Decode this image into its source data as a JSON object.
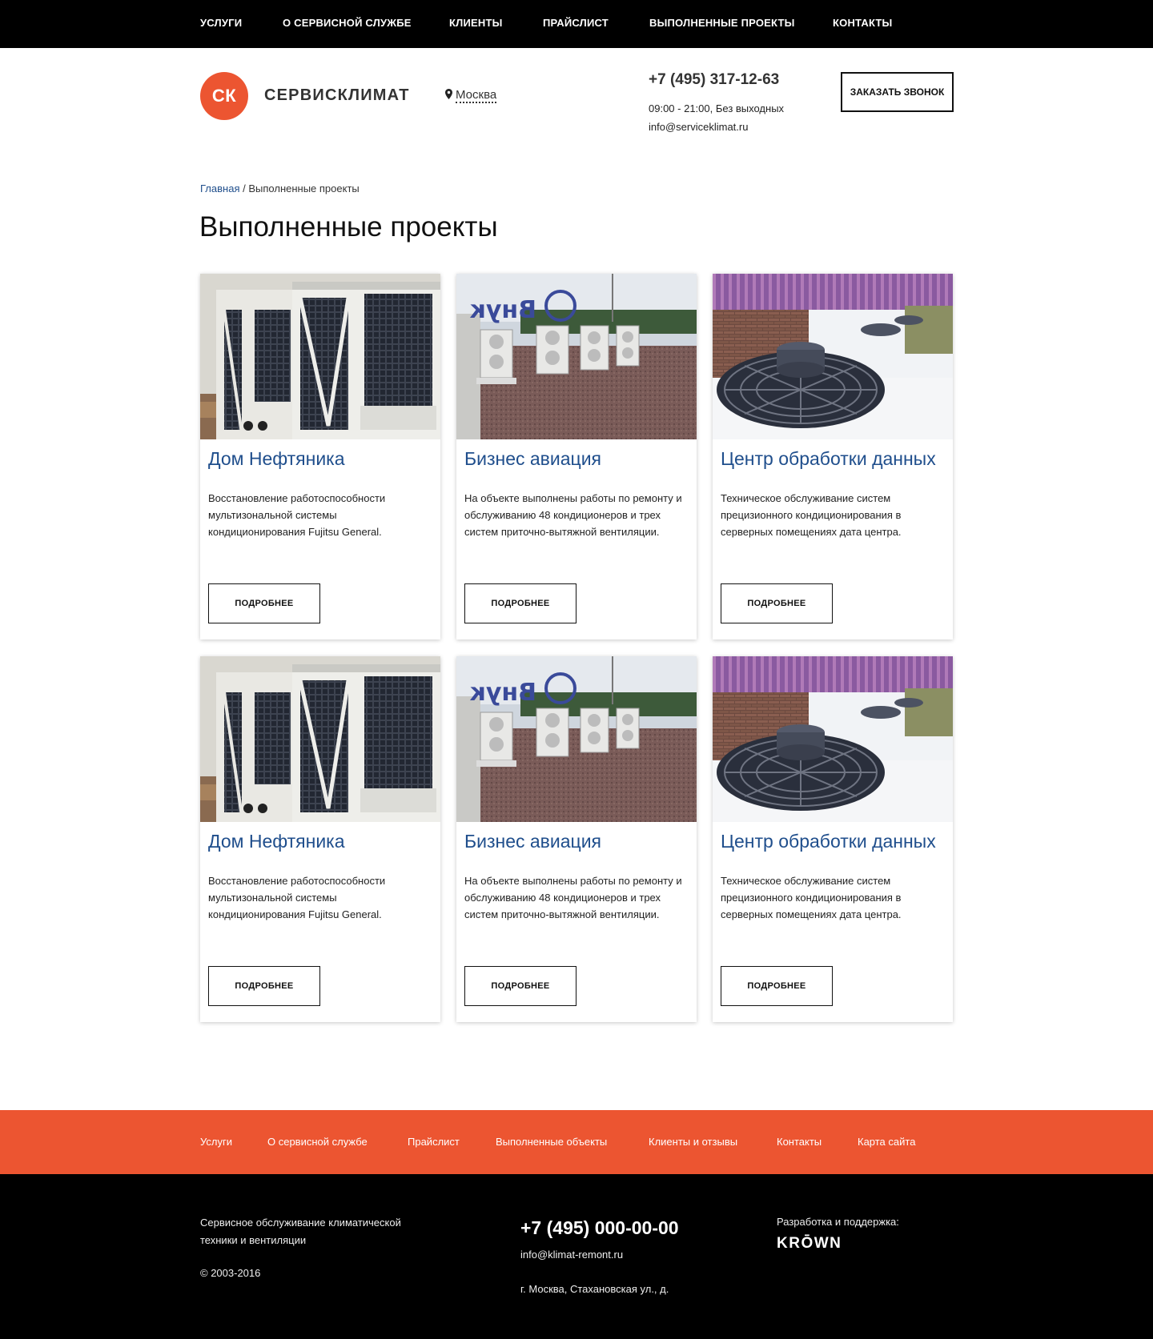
{
  "topnav": {
    "items": [
      {
        "label": "УСЛУГИ"
      },
      {
        "label": "О СЕРВИСНОЙ СЛУЖБЕ"
      },
      {
        "label": "КЛИЕНТЫ"
      },
      {
        "label": "ПРАЙСЛИСТ"
      },
      {
        "label": "ВЫПОЛНЕННЫЕ ПРОЕКТЫ"
      },
      {
        "label": "КОНТАКТЫ"
      }
    ]
  },
  "header": {
    "logo_mark": "СК",
    "logo_text": "СЕРВИСКЛИМАТ",
    "city_icon": "map-pin-icon",
    "city": "Москва",
    "phone": "+7 (495) 317-12-63",
    "hours": "09:00 - 21:00, Без выходных",
    "email": "info@serviceklimat.ru",
    "callback_label": "ЗАКАЗАТЬ ЗВОНОК"
  },
  "breadcrumb": {
    "home": "Главная",
    "separator": "/",
    "current": "Выполненные проекты"
  },
  "page_title": "Выполненные проекты",
  "projects": [
    {
      "title": "Дом Нефтяника",
      "text": "Восстановление работоспособности мультизональной системы кондиционирования Fujitsu General.",
      "button": "ПОДРОБНЕЕ",
      "image": "outdoor-chiller-units"
    },
    {
      "title": "Бизнес авиация",
      "text": "На объекте выполнены работы по ремонту и обслуживанию 48 кондиционеров и трех систем приточно-вытяжной вентиляции.",
      "button": "ПОДРОБНЕЕ",
      "image": "rooftop-condensers-vnukovo"
    },
    {
      "title": "Центр обработки данных",
      "text": "Техническое обслуживание систем прецизионного кондиционирования в серверных помещениях дата центра.",
      "button": "ПОДРОБНЕЕ",
      "image": "rooftop-fan-units"
    },
    {
      "title": "Дом Нефтяника",
      "text": "Восстановление работоспособности мультизональной системы кондиционирования Fujitsu General.",
      "button": "ПОДРОБНЕЕ",
      "image": "outdoor-chiller-units"
    },
    {
      "title": "Бизнес авиация",
      "text": "На объекте выполнены работы по ремонту и обслуживанию 48 кондиционеров и трех систем приточно-вытяжной вентиляции.",
      "button": "ПОДРОБНЕЕ",
      "image": "rooftop-condensers-vnukovo"
    },
    {
      "title": "Центр обработки данных",
      "text": "Техническое обслуживание систем прецизионного кондиционирования в серверных помещениях дата центра.",
      "button": "ПОДРОБНЕЕ",
      "image": "rooftop-fan-units"
    }
  ],
  "footer_nav": {
    "items": [
      {
        "label": "Услуги"
      },
      {
        "label": "О сервисной службе"
      },
      {
        "label": "Прайслист"
      },
      {
        "label": "Выполненные объекты"
      },
      {
        "label": "Клиенты и отзывы"
      },
      {
        "label": "Контакты"
      },
      {
        "label": "Карта сайта"
      }
    ]
  },
  "footer": {
    "description": "Сервисное обслуживание климатической техники и вентиляции",
    "copyright": "© 2003-2016",
    "phone": "+7 (495) 000-00-00",
    "email": "info@klimat-remont.ru",
    "address": "г. Москва, Стахановская ул., д.",
    "dev_label": "Разработка и поддержка:",
    "dev_logo": "KRŌWN"
  },
  "colors": {
    "accent": "#ec5531",
    "link": "#1f4e8c",
    "nav_bg": "#000000"
  }
}
